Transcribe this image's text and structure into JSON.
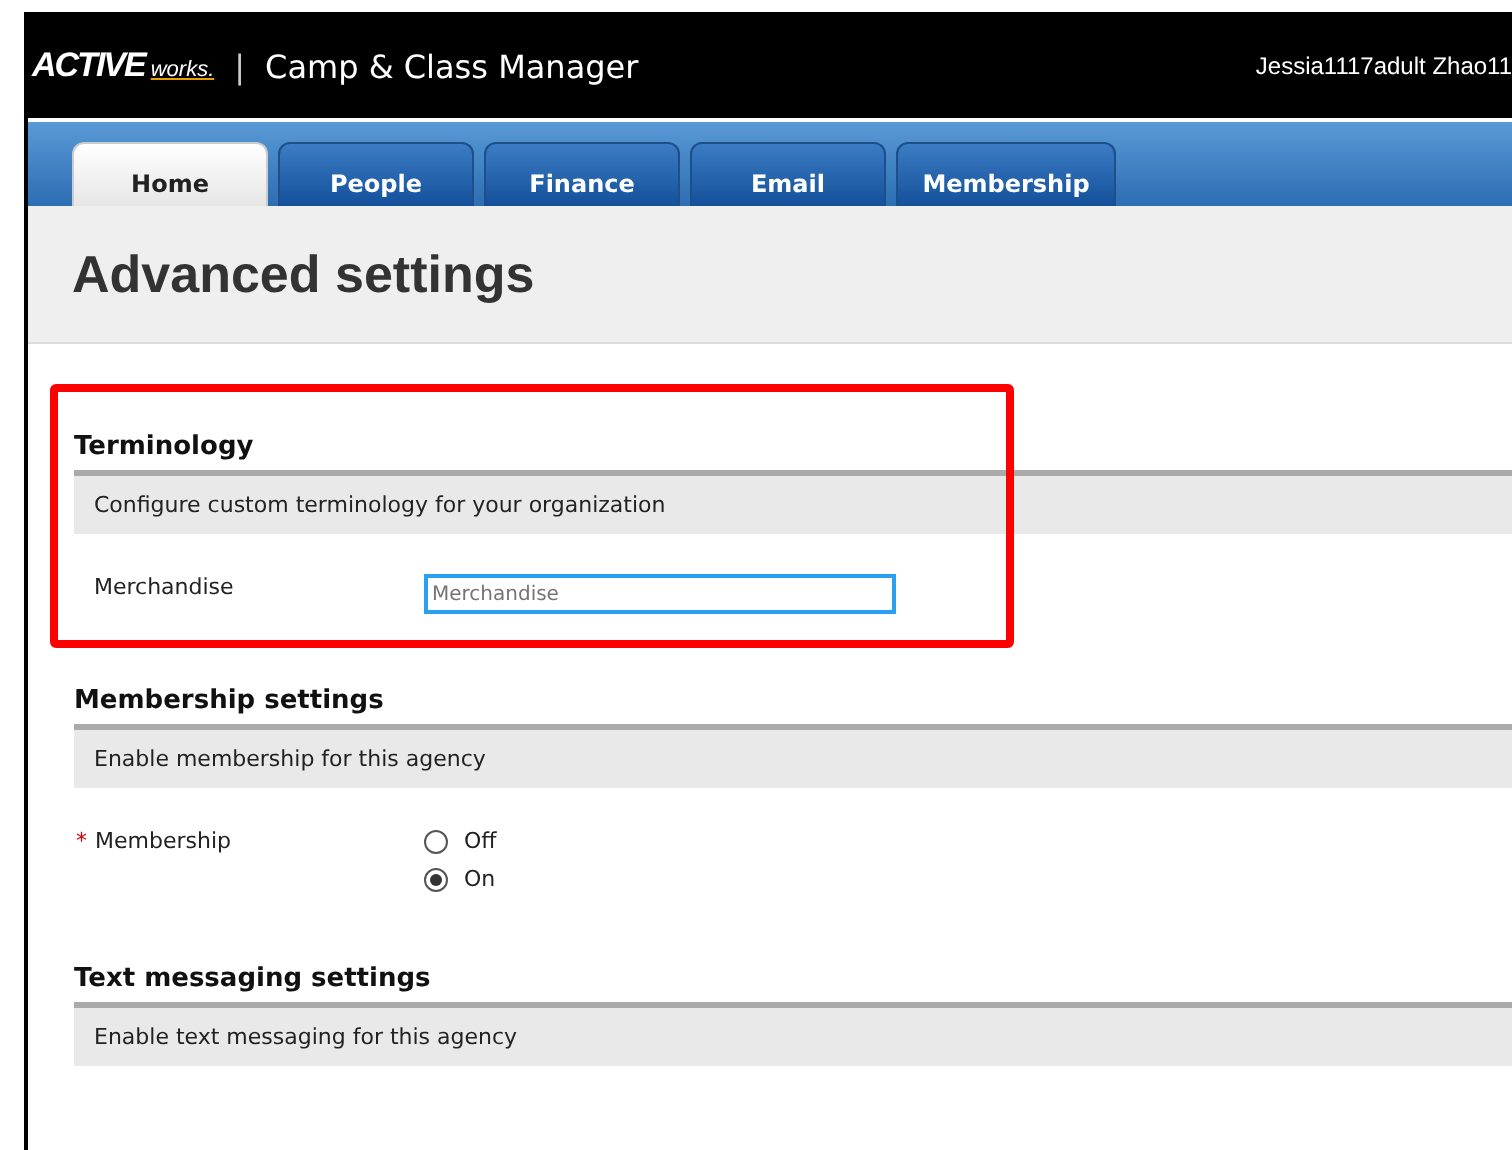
{
  "header": {
    "logo": {
      "brand": "ACTIVE",
      "suffix": "works."
    },
    "separator": "|",
    "app_title": "Camp & Class Manager",
    "user": "Jessia1117adult Zhao11"
  },
  "tabs": [
    {
      "label": "Home",
      "selected": true
    },
    {
      "label": "People",
      "selected": false
    },
    {
      "label": "Finance",
      "selected": false
    },
    {
      "label": "Email",
      "selected": false
    },
    {
      "label": "Membership",
      "selected": false
    }
  ],
  "page_title": "Advanced settings",
  "sections": [
    {
      "title": "Terminology",
      "description": "Configure custom terminology for your organization",
      "highlighted": true,
      "fields": [
        {
          "kind": "text",
          "label": "Merchandise",
          "placeholder": "Merchandise",
          "focused": true
        }
      ]
    },
    {
      "title": "Membership settings",
      "description": "Enable membership for this agency",
      "highlighted": false,
      "fields": [
        {
          "kind": "radio",
          "label": "Membership",
          "required_mark": "*",
          "options": [
            {
              "label": "Off",
              "selected": false
            },
            {
              "label": "On",
              "selected": true
            }
          ]
        }
      ]
    },
    {
      "title": "Text messaging settings",
      "description": "Enable text messaging for this agency",
      "highlighted": false
    }
  ]
}
